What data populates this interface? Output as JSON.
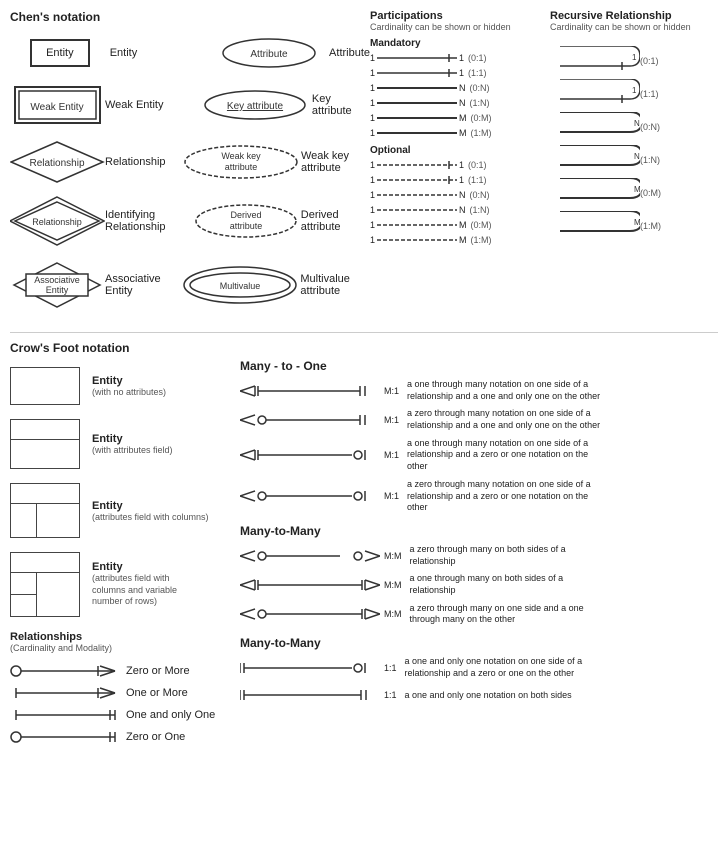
{
  "chen": {
    "title": "Chen's notation",
    "rows": [
      {
        "shape": "entity",
        "shape_label": "Entity",
        "attr": "ellipse",
        "attr_text": "Attribute",
        "attr_label": "Attribute"
      },
      {
        "shape": "weak_entity",
        "shape_label": "Weak Entity",
        "attr": "ellipse_key",
        "attr_text": "Key attribute",
        "attr_label": "Key attribute"
      },
      {
        "shape": "diamond",
        "shape_label": "Relationship",
        "attr": "ellipse_weak_key",
        "attr_text": "Weak key attribute",
        "attr_label": "Weak key attribute"
      },
      {
        "shape": "diamond_double",
        "shape_label": "Identifying Relationship",
        "attr": "ellipse_derived",
        "attr_text": "Derived attribute",
        "attr_label": "Derived attribute"
      },
      {
        "shape": "assoc_entity",
        "shape_label": "Associative Entity",
        "attr": "ellipse_multi",
        "attr_text": "Multivalue attribute",
        "attr_label": "Multivalue attribute"
      }
    ]
  },
  "participations": {
    "title": "Participations",
    "subtitle": "Cardinality can be shown or hidden",
    "mandatory_title": "Mandatory",
    "optional_title": "Optional",
    "mandatory_rows": [
      {
        "left": "1",
        "right": "1",
        "cardinality": "(0:1)"
      },
      {
        "left": "1",
        "right": "1",
        "cardinality": "(1:1)"
      },
      {
        "left": "1",
        "right": "N",
        "cardinality": "(0:N)"
      },
      {
        "left": "1",
        "right": "N",
        "cardinality": "(1:N)"
      },
      {
        "left": "1",
        "right": "M",
        "cardinality": "(0:M)"
      },
      {
        "left": "1",
        "right": "M",
        "cardinality": "(1:M)"
      }
    ],
    "optional_rows": [
      {
        "left": "1",
        "right": "1",
        "cardinality": "(0:1)"
      },
      {
        "left": "1",
        "right": "1",
        "cardinality": "(1:1)"
      },
      {
        "left": "1",
        "right": "N",
        "cardinality": "(0:N)"
      },
      {
        "left": "1",
        "right": "N",
        "cardinality": "(1:N)"
      },
      {
        "left": "1",
        "right": "M",
        "cardinality": "(0:M)"
      },
      {
        "left": "1",
        "right": "M",
        "cardinality": "(1:M)"
      }
    ]
  },
  "recursive": {
    "title": "Recursive Relationship",
    "subtitle": "Cardinality can be shown or hidden",
    "mandatory_rows": [
      {
        "right": "1",
        "cardinality": "(0:1)"
      },
      {
        "right": "1",
        "cardinality": "(1:1)"
      },
      {
        "right": "N",
        "cardinality": "(0:N)"
      },
      {
        "right": "N",
        "cardinality": "(1:N)"
      },
      {
        "right": "M",
        "cardinality": "(0:M)"
      },
      {
        "right": "M",
        "cardinality": "(1:M)"
      }
    ]
  },
  "crows": {
    "title": "Crow's Foot notation",
    "entities": [
      {
        "label": "Entity",
        "sublabel": "(with no attributes)",
        "type": "simple"
      },
      {
        "label": "Entity",
        "sublabel": "(with attributes field)",
        "type": "attr"
      },
      {
        "label": "Entity",
        "sublabel": "(attributes field with columns)",
        "type": "cols"
      },
      {
        "label": "Entity",
        "sublabel": "(attributes field with columns and variable number of rows)",
        "type": "rows"
      }
    ],
    "relationships_title": "Relationships",
    "relationships_subtitle": "(Cardinality and Modality)",
    "cardinality_rows": [
      {
        "label": "Zero or More"
      },
      {
        "label": "One or More"
      },
      {
        "label": "One and only One"
      },
      {
        "label": "Zero or One"
      }
    ],
    "many_to_one_title": "Many - to - One",
    "many_to_one": [
      {
        "ratio": "M:1",
        "desc": "a one through many notation on one side of a relationship and a one and only one on the other"
      },
      {
        "ratio": "M:1",
        "desc": "a zero through many notation on one side of a relationship and a one and only one on the other"
      },
      {
        "ratio": "M:1",
        "desc": "a one through many notation on one side of a relationship and a zero or one notation on the other"
      },
      {
        "ratio": "M:1",
        "desc": "a zero through many notation on one side of a relationship and a zero or one notation on the other"
      }
    ],
    "many_to_many_title": "Many-to-Many",
    "many_to_many": [
      {
        "ratio": "M:M",
        "desc": "a zero through many on both sides of a relationship"
      },
      {
        "ratio": "M:M",
        "desc": "a one through many on both sides of a relationship"
      },
      {
        "ratio": "M:M",
        "desc": "a zero through many on one side and a one through many on the other"
      }
    ],
    "many_to_many_2_title": "Many-to-Many",
    "one_to_one": [
      {
        "ratio": "1:1",
        "desc": "a one and only one notation on one side of a relationship and a zero or one on the other"
      },
      {
        "ratio": "1:1",
        "desc": "a one and only one notation on both sides"
      }
    ]
  }
}
